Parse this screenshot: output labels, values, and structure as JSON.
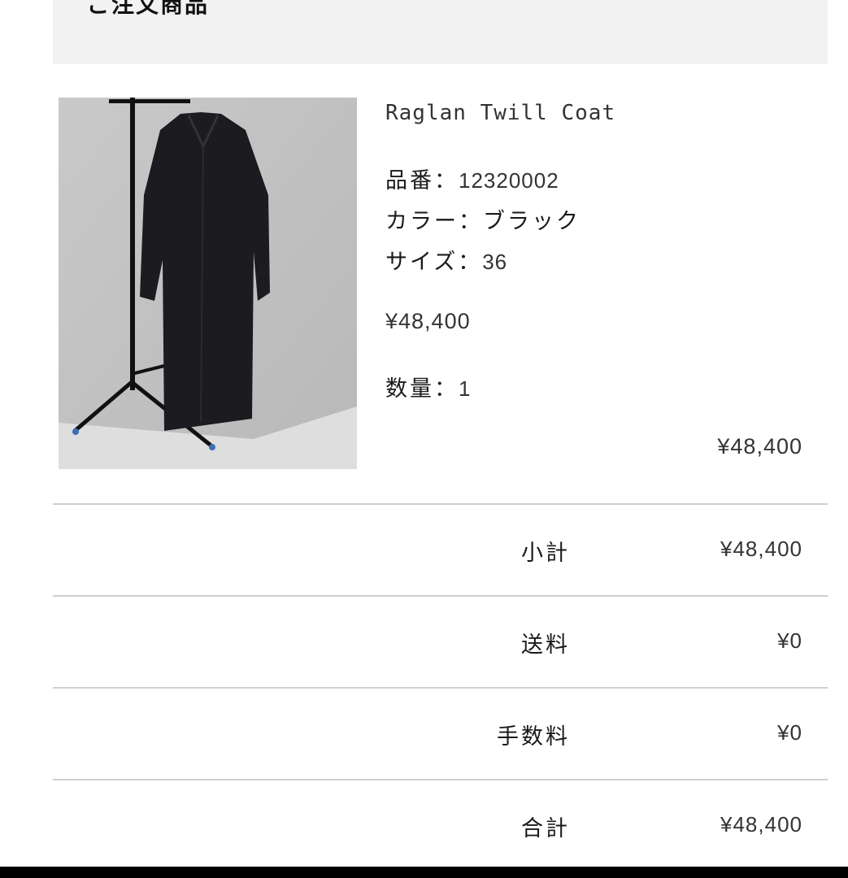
{
  "header": {
    "title": "ご注文商品"
  },
  "product": {
    "name": "Raglan Twill Coat",
    "sku_label": "品番：",
    "sku": "12320002",
    "color_label": "カラー：",
    "color": "ブラック",
    "size_label": "サイズ：",
    "size": "36",
    "price": "¥48,400",
    "qty_label": "数量：",
    "qty": "1",
    "line_total": "¥48,400"
  },
  "summary": [
    {
      "label": "小計",
      "value": "¥48,400"
    },
    {
      "label": "送料",
      "value": "¥0"
    },
    {
      "label": "手数料",
      "value": "¥0"
    },
    {
      "label": "合計",
      "value": "¥48,400"
    }
  ],
  "colors": {
    "header_bg": "#f2f2f2",
    "divider": "#cfcfcf"
  }
}
